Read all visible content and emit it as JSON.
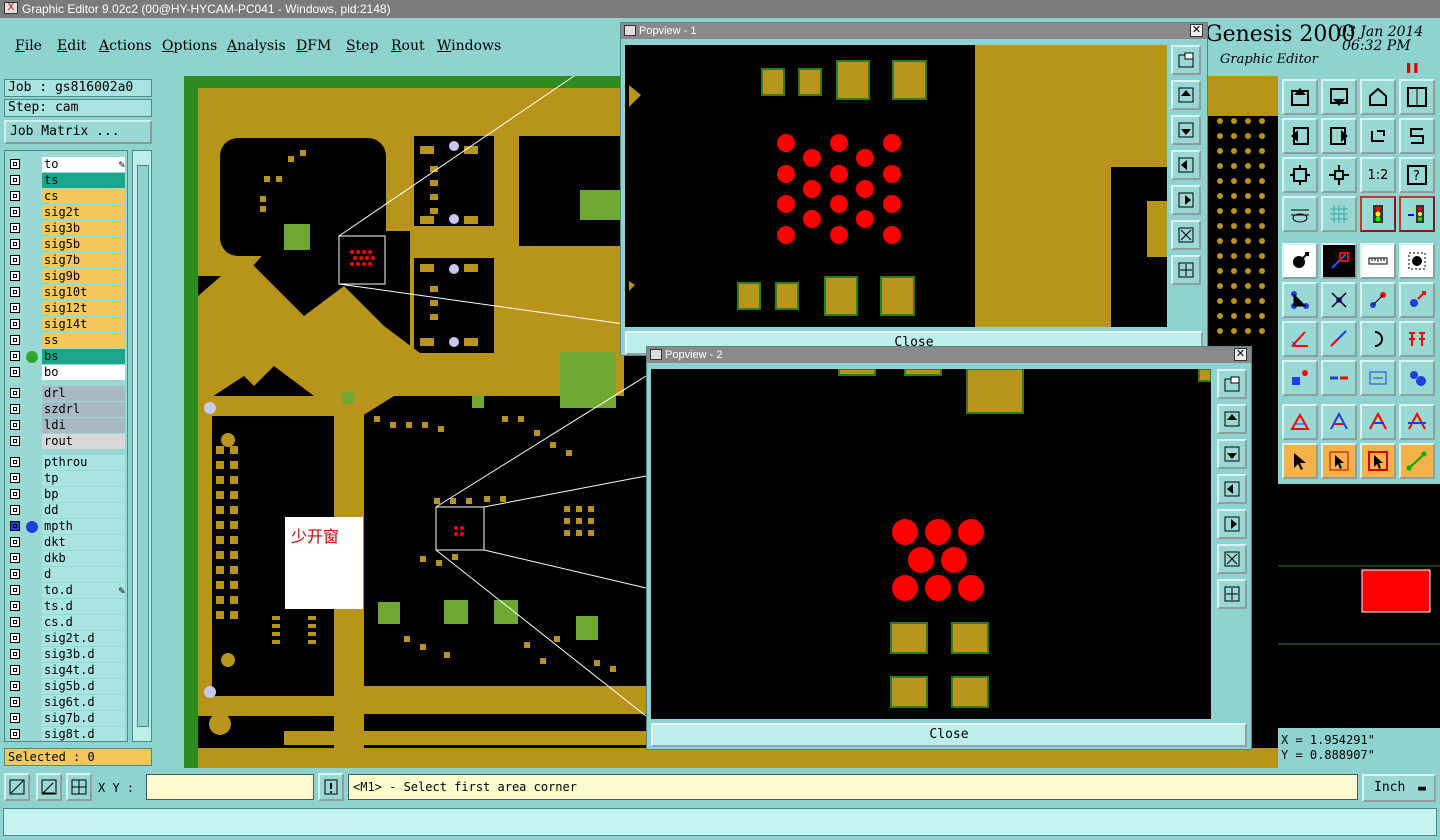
{
  "window": {
    "title": "Graphic Editor 9.02c2 (00@HY-HYCAM-PC041 - Windows, pid:2148)"
  },
  "menu": [
    "File",
    "Edit",
    "Actions",
    "Options",
    "Analysis",
    "DFM",
    "Step",
    "Rout",
    "Windows"
  ],
  "brand": {
    "name": "Genesis 2000",
    "subtitle": "Graphic Editor",
    "date": "03 Jan 2014",
    "time": "06:32 PM"
  },
  "job": {
    "label": "Job : gs816002a0",
    "step": "Step: cam",
    "matrix_button": "Job Matrix ..."
  },
  "layers": [
    {
      "name": "to",
      "color": "#ffffff",
      "note": "pencil"
    },
    {
      "name": "ts",
      "color": "#1aa58c"
    },
    {
      "name": "cs",
      "color": "#f5c85e"
    },
    {
      "name": "sig2t",
      "color": "#f5c85e"
    },
    {
      "name": "sig3b",
      "color": "#f5c85e"
    },
    {
      "name": "sig5b",
      "color": "#f5c85e"
    },
    {
      "name": "sig7b",
      "color": "#f5c85e"
    },
    {
      "name": "sig9b",
      "color": "#f5c85e"
    },
    {
      "name": "sig10t",
      "color": "#f5c85e"
    },
    {
      "name": "sig12t",
      "color": "#f5c85e"
    },
    {
      "name": "sig14t",
      "color": "#f5c85e"
    },
    {
      "name": "ss",
      "color": "#f5c85e"
    },
    {
      "name": "bs",
      "color": "#1aa58c",
      "dot": "#2aa82a"
    },
    {
      "name": "bo",
      "color": "#ffffff"
    },
    {
      "name": "drl",
      "color": "#a9b9c2",
      "gap": true
    },
    {
      "name": "szdrl",
      "color": "#a9b9c2"
    },
    {
      "name": "ldi",
      "color": "#a9b9c2"
    },
    {
      "name": "rout",
      "color": "#d8d8d8"
    },
    {
      "name": "pthrou",
      "color": "#a8e4e0",
      "gap": true
    },
    {
      "name": "tp",
      "color": "#a8e4e0"
    },
    {
      "name": "bp",
      "color": "#a8e4e0"
    },
    {
      "name": "dd",
      "color": "#a8e4e0"
    },
    {
      "name": "mpth",
      "color": "#a8e4e0",
      "dot": "#1f3fe0",
      "active": true
    },
    {
      "name": "dkt",
      "color": "#a8e4e0"
    },
    {
      "name": "dkb",
      "color": "#a8e4e0"
    },
    {
      "name": "d",
      "color": "#a8e4e0"
    },
    {
      "name": "to.d",
      "color": "#a8e4e0",
      "note": "pencil"
    },
    {
      "name": "ts.d",
      "color": "#a8e4e0"
    },
    {
      "name": "cs.d",
      "color": "#a8e4e0"
    },
    {
      "name": "sig2t.d",
      "color": "#a8e4e0"
    },
    {
      "name": "sig3b.d",
      "color": "#a8e4e0"
    },
    {
      "name": "sig4t.d",
      "color": "#a8e4e0"
    },
    {
      "name": "sig5b.d",
      "color": "#a8e4e0"
    },
    {
      "name": "sig6t.d",
      "color": "#a8e4e0"
    },
    {
      "name": "sig7b.d",
      "color": "#a8e4e0"
    },
    {
      "name": "sig8t.d",
      "color": "#a8e4e0"
    }
  ],
  "selected": "Selected : 0",
  "popviews": [
    {
      "title": "Popview - 1",
      "close_label": "Close"
    },
    {
      "title": "Popview - 2",
      "close_label": "Close"
    }
  ],
  "annotation": {
    "text": "少开窗"
  },
  "coords": {
    "x": "X = 1.954291\"",
    "y": "Y = 0.888907\""
  },
  "bottom": {
    "xy_label": "X Y :",
    "xy_value": "",
    "status": "<M1> - Select first area corner",
    "unit": "Inch"
  },
  "colors": {
    "copper": "#b8951a",
    "mask": "#2e7d1e",
    "pad_red": "#ff0000",
    "panel": "#8fd3d0"
  }
}
